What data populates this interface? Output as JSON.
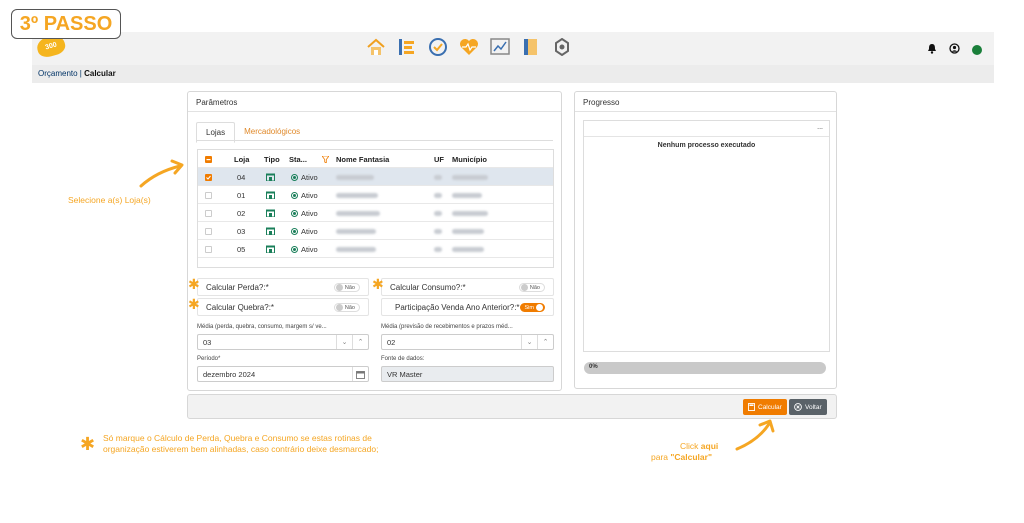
{
  "step_badge": "3º PASSO",
  "logo_text": "300",
  "breadcrumb": {
    "parent": "Orçamento",
    "separator": " | ",
    "current": "Calcular"
  },
  "parametros": {
    "title": "Parâmetros",
    "tabs": [
      "Lojas",
      "Mercadológicos"
    ],
    "grid": {
      "headers": [
        "Loja",
        "Tipo",
        "Sta...",
        "Nome Fantasia",
        "UF",
        "Município"
      ],
      "rows": [
        {
          "loja": "04",
          "status": "Ativo",
          "selected": true
        },
        {
          "loja": "01",
          "status": "Ativo",
          "selected": false
        },
        {
          "loja": "02",
          "status": "Ativo",
          "selected": false
        },
        {
          "loja": "03",
          "status": "Ativo",
          "selected": false
        },
        {
          "loja": "05",
          "status": "Ativo",
          "selected": false
        }
      ]
    },
    "options": {
      "perda": {
        "label": "Calcular Perda?:*",
        "value": "Não"
      },
      "quebra": {
        "label": "Calcular Quebra?:*",
        "value": "Não"
      },
      "consumo": {
        "label": "Calcular Consumo?:*",
        "value": "Não"
      },
      "participacao": {
        "label": "Participação Venda Ano Anterior?:*",
        "value": "Sim"
      }
    },
    "media1": {
      "label": "Média (perda, quebra, consumo, margem s/ ve...",
      "value": "03"
    },
    "media2": {
      "label": "Média (previsão de recebimentos e prazos méd...",
      "value": "02"
    },
    "periodo": {
      "label": "Período*",
      "value": "dezembro 2024"
    },
    "fonte": {
      "label": "Fonte de dados:",
      "value": "VR Master"
    }
  },
  "progresso": {
    "title": "Progresso",
    "menu": "...",
    "empty_message": "Nenhum processo executado",
    "progress_label": "0%",
    "progress_value": 0
  },
  "actions": {
    "calcular": "Calcular",
    "voltar": "Voltar"
  },
  "annotations": {
    "select_loja": "Selecione a(s) Loja(s)",
    "note_line1": "Só marque o Cálculo de Perda, Quebra e Consumo se estas rotinas de",
    "note_line2": "organização estiverem bem alinhadas, caso contrário deixe desmarcado;",
    "click_line1_pre": "Click ",
    "click_line1_bold": "aqui",
    "click_line2_pre": "para ",
    "click_line2_bold": "\"Calcular\""
  },
  "colors": {
    "accent": "#f07c00",
    "annotation": "#f5a623",
    "status_green": "#1a7f5a"
  }
}
